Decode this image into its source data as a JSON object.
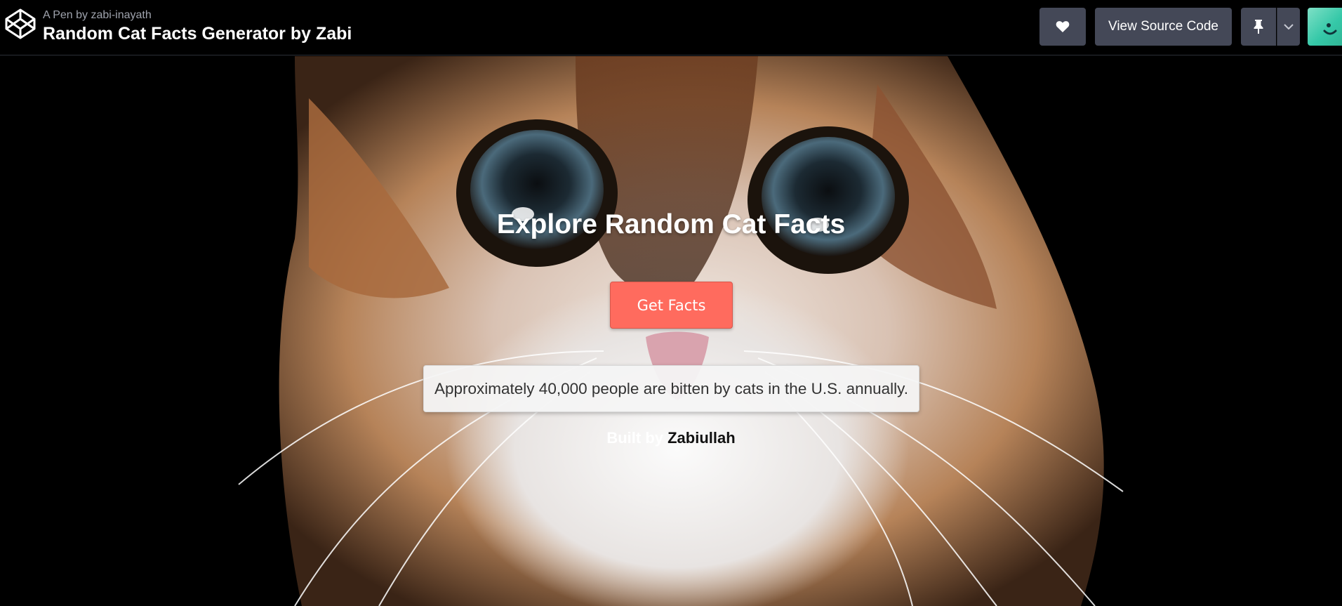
{
  "header": {
    "pen_by_prefix": "A Pen by ",
    "author_handle": "zabi-inayath",
    "title": "Random Cat Facts Generator by Zabi",
    "source_button_label": "View Source Code",
    "logo_icon": "codepen-logo-icon",
    "like_icon": "heart-icon",
    "pin_icon": "pin-icon",
    "caret_icon": "chevron-down-icon"
  },
  "main": {
    "headline": "Explore Random Cat Facts",
    "get_facts_label": "Get Facts",
    "fact_text": "Approximately 40,000 people are bitten by cats in the U.S. annually.",
    "built_by_prefix": "Built by ",
    "built_by_author": "Zabiullah",
    "background_subject": "cat-photo"
  },
  "colors": {
    "topbar_bg": "#000000",
    "button_bg": "#444857",
    "accent_button": "#ff6b5e",
    "fact_bg": "#f4f4f4"
  }
}
